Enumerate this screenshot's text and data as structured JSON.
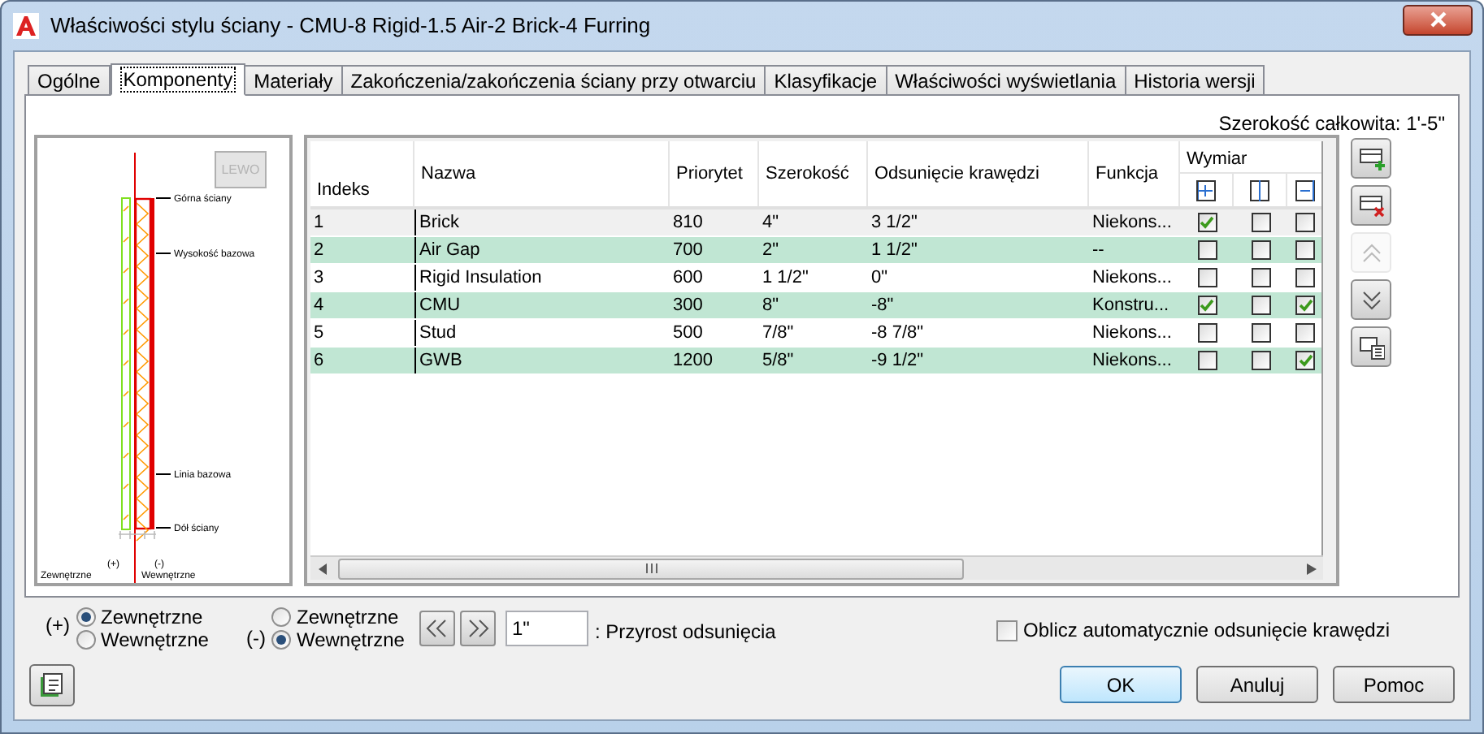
{
  "window": {
    "title": "Właściwości stylu ściany - CMU-8 Rigid-1.5 Air-2 Brick-4 Furring"
  },
  "tabs": [
    {
      "label": "Ogólne",
      "selected": false
    },
    {
      "label": "Komponenty",
      "selected": true
    },
    {
      "label": "Materiały",
      "selected": false
    },
    {
      "label": "Zakończenia/zakończenia ściany przy otwarciu",
      "selected": false
    },
    {
      "label": "Klasyfikacje",
      "selected": false
    },
    {
      "label": "Właściwości wyświetlania",
      "selected": false
    },
    {
      "label": "Historia wersji",
      "selected": false
    }
  ],
  "total_width": "Szerokość całkowita: 1'-5\"",
  "preview": {
    "view_button": "LEWO",
    "labels": [
      "Górna ściany",
      "Wysokość bazowa",
      "Linia bazowa",
      "Dół ściany"
    ],
    "plus_mark": "(+)",
    "plus_label": "Zewnętrzne",
    "minus_mark": "(-)",
    "minus_label": "Wewnętrzne"
  },
  "table": {
    "columns": [
      "Indeks",
      "Nazwa",
      "Priorytet",
      "Szerokość",
      "Odsunięcie krawędzi",
      "Funkcja"
    ],
    "dimension_header": "Wymiar",
    "rows": [
      {
        "cells": [
          "1",
          "Brick",
          "810",
          "4\"",
          "3 1/2\"",
          "Niekons..."
        ],
        "checks": [
          true,
          false,
          false
        ],
        "selected": true
      },
      {
        "cells": [
          "2",
          "Air Gap",
          "700",
          "2\"",
          "1 1/2\"",
          "--"
        ],
        "checks": [
          false,
          false,
          false
        ],
        "selected": false
      },
      {
        "cells": [
          "3",
          "Rigid Insulation",
          "600",
          "1 1/2\"",
          "0\"",
          "Niekons..."
        ],
        "checks": [
          false,
          false,
          false
        ],
        "selected": false
      },
      {
        "cells": [
          "4",
          "CMU",
          "300",
          "8\"",
          "-8\"",
          "Konstru..."
        ],
        "checks": [
          true,
          false,
          true
        ],
        "selected": false
      },
      {
        "cells": [
          "5",
          "Stud",
          "500",
          "7/8\"",
          "-8 7/8\"",
          "Niekons..."
        ],
        "checks": [
          false,
          false,
          false
        ],
        "selected": false
      },
      {
        "cells": [
          "6",
          "GWB",
          "1200",
          "5/8\"",
          "-9 1/2\"",
          "Niekons..."
        ],
        "checks": [
          false,
          false,
          true
        ],
        "selected": false
      }
    ]
  },
  "side_buttons": [
    {
      "kind": "add",
      "disabled": false
    },
    {
      "kind": "delete",
      "disabled": false
    },
    {
      "kind": "up",
      "disabled": true
    },
    {
      "kind": "down",
      "disabled": false
    },
    {
      "kind": "details",
      "disabled": false
    }
  ],
  "plus_side": {
    "mark": "(+)",
    "options": [
      {
        "label": "Zewnętrzne",
        "selected": true
      },
      {
        "label": "Wewnętrzne",
        "selected": false
      }
    ]
  },
  "minus_side": {
    "mark": "(-)",
    "options": [
      {
        "label": "Zewnętrzne",
        "selected": false
      },
      {
        "label": "Wewnętrzne",
        "selected": true
      }
    ]
  },
  "offset_increment": {
    "value": "1\"",
    "label": ": Przyrost odsunięcia"
  },
  "auto_offset": {
    "label": "Oblicz automatycznie odsunięcie krawędzi",
    "checked": false
  },
  "buttons": [
    {
      "label": "OK",
      "default": true
    },
    {
      "label": "Anuluj",
      "default": false
    },
    {
      "label": "Pomoc",
      "default": false
    }
  ]
}
